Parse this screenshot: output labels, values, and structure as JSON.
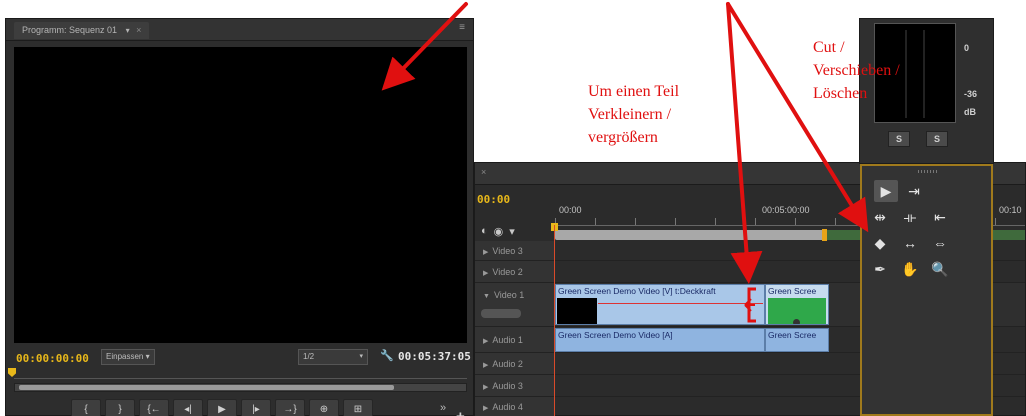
{
  "monitor": {
    "tab_label": "Programm: Sequenz 01",
    "timecode_current": "00:00:00:00",
    "fit_label": "Einpassen",
    "resolution_label": "1/2",
    "timecode_duration": "00:05:37:05"
  },
  "transport": {
    "buttons": [
      "{",
      "}",
      "{←",
      "◂|",
      "▶",
      "|▸",
      "→}",
      "⊕",
      "⊞"
    ]
  },
  "timeline": {
    "timecode": "00:00",
    "ruler": [
      "00:00",
      "00:05:00:00",
      "00:10"
    ],
    "tracks": {
      "video3": "Video 3",
      "video2": "Video 2",
      "video1": "Video 1",
      "audio1": "Audio 1",
      "audio2": "Audio 2",
      "audio3": "Audio 3",
      "audio4": "Audio 4"
    },
    "clips": {
      "video_main": "Green Screen Demo Video [V]",
      "video_effect": "t:Deckkraft",
      "video_next": "Green Scree",
      "audio_main": "Green Screen Demo Video [A]",
      "audio_next": "Green Scree"
    }
  },
  "meter": {
    "db_top": "0",
    "db_mid": "-36",
    "db_unit": "dB",
    "solo_left": "S",
    "solo_right": "S"
  },
  "tools": [
    {
      "name": "selection-tool",
      "glyph": "▶"
    },
    {
      "name": "track-select-tool",
      "glyph": "⇥"
    },
    {
      "name": "ripple-edit-tool",
      "glyph": "⇹"
    },
    {
      "name": "rolling-edit-tool",
      "glyph": "⟛"
    },
    {
      "name": "rate-stretch-tool",
      "glyph": "⇤"
    },
    {
      "name": "razor-tool",
      "glyph": "◆"
    },
    {
      "name": "slip-tool",
      "glyph": "↔"
    },
    {
      "name": "slide-tool",
      "glyph": "⇔"
    },
    {
      "name": "pen-tool",
      "glyph": "✒"
    },
    {
      "name": "hand-tool",
      "glyph": "✋"
    },
    {
      "name": "zoom-tool",
      "glyph": "🔍"
    }
  ],
  "annotations": {
    "trim_line1": "Um einen Teil",
    "trim_line2": "Verkleinern /",
    "trim_line3": "vergrößern",
    "tools_line1": "Cut /",
    "tools_line2": "Verschieben /",
    "tools_line3": "Löschen"
  },
  "colors": {
    "timecode": "#e8b81a",
    "annotation": "#e01010",
    "clip": "#a9c7e8",
    "panel_border": "#a07a1c"
  }
}
